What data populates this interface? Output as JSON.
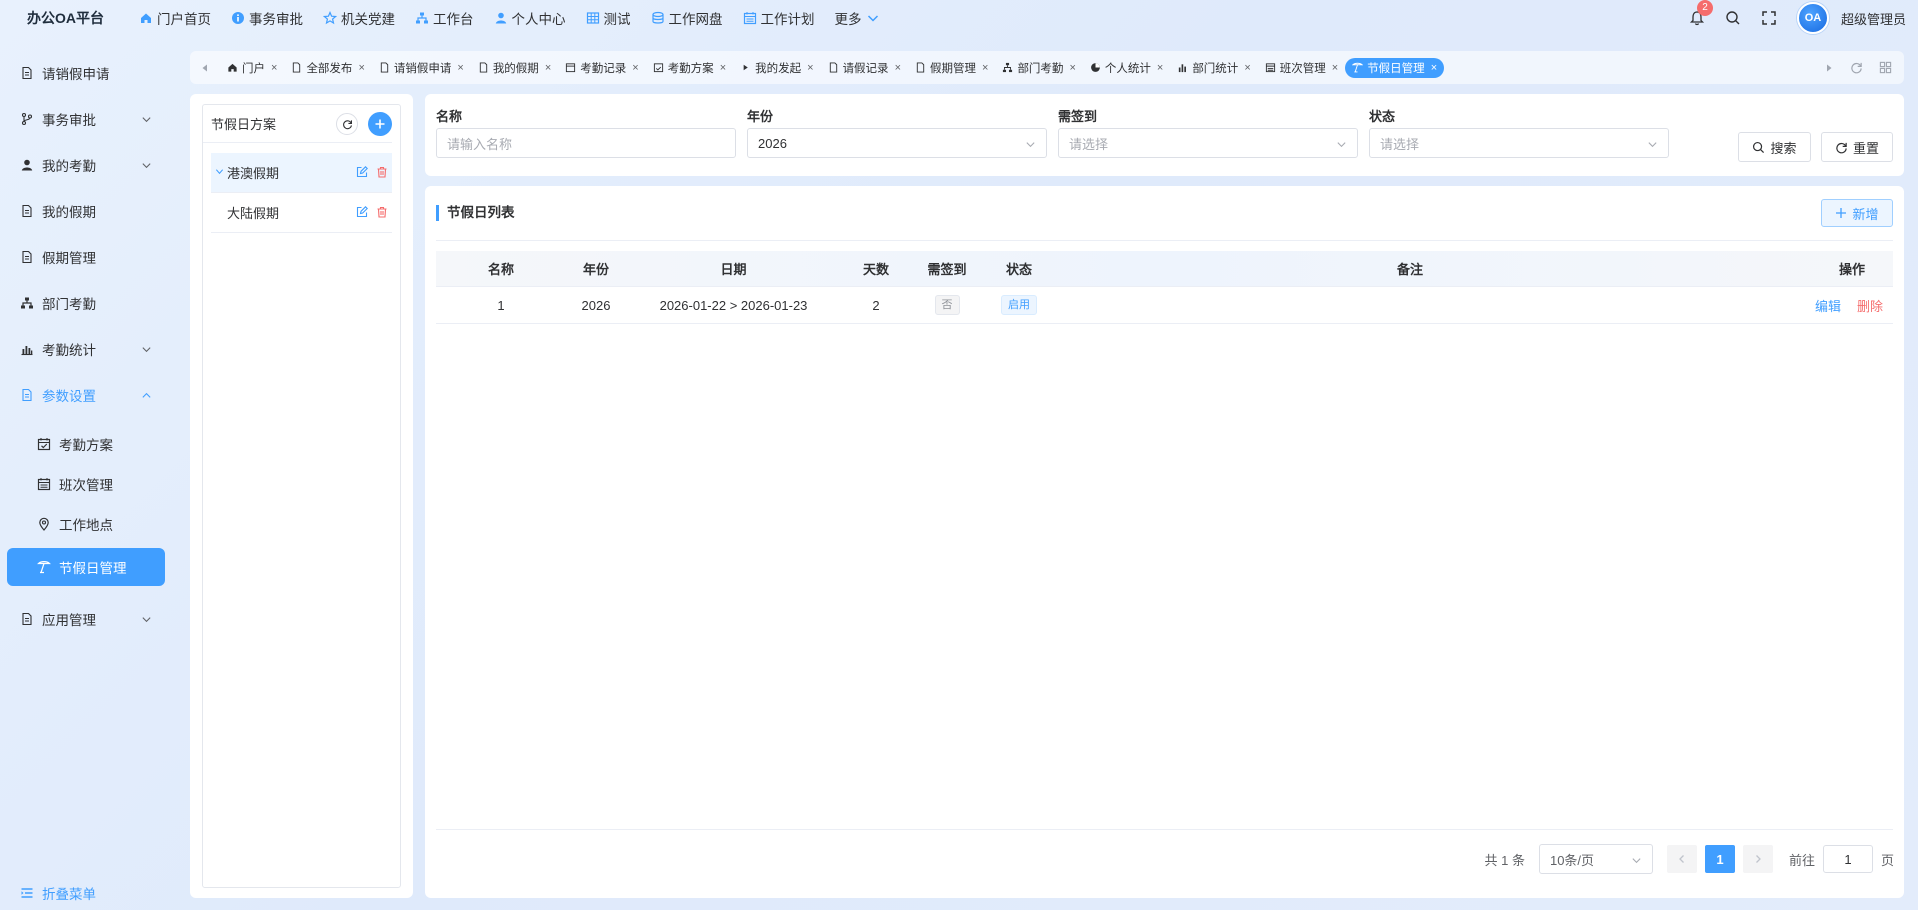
{
  "app": {
    "title": "办公OA平台",
    "username": "超级管理员",
    "avatar_text": "OA",
    "notification_count": "2"
  },
  "topnav": [
    {
      "label": "门户首页",
      "icon": "home-icon"
    },
    {
      "label": "事务审批",
      "icon": "info-icon"
    },
    {
      "label": "机关党建",
      "icon": "star-icon"
    },
    {
      "label": "工作台",
      "icon": "org-icon"
    },
    {
      "label": "个人中心",
      "icon": "user-icon"
    },
    {
      "label": "测试",
      "icon": "grid-icon"
    },
    {
      "label": "工作网盘",
      "icon": "database-icon"
    },
    {
      "label": "工作计划",
      "icon": "calendar-icon"
    },
    {
      "label": "更多",
      "icon": "chevron-down-icon"
    }
  ],
  "sidebar": {
    "items": [
      {
        "label": "请销假申请",
        "icon": "doc-icon"
      },
      {
        "label": "事务审批",
        "icon": "branch-icon",
        "expandable": true
      },
      {
        "label": "我的考勤",
        "icon": "user-icon",
        "expandable": true
      },
      {
        "label": "我的假期",
        "icon": "doc-icon"
      },
      {
        "label": "假期管理",
        "icon": "doc-icon"
      },
      {
        "label": "部门考勤",
        "icon": "org-icon"
      },
      {
        "label": "考勤统计",
        "icon": "chart-icon",
        "expandable": true
      },
      {
        "label": "参数设置",
        "icon": "doc-icon",
        "expandable": true,
        "expanded": true
      }
    ],
    "sub_items": [
      {
        "label": "考勤方案",
        "icon": "calendar-check-icon"
      },
      {
        "label": "班次管理",
        "icon": "calendar-icon"
      },
      {
        "label": "工作地点",
        "icon": "location-icon"
      },
      {
        "label": "节假日管理",
        "icon": "holiday-icon",
        "active": true
      }
    ],
    "after_items": [
      {
        "label": "应用管理",
        "icon": "doc-icon",
        "expandable": true
      }
    ],
    "collapse_label": "折叠菜单"
  },
  "tabs": [
    {
      "label": "门户",
      "icon": "home-icon"
    },
    {
      "label": "全部发布",
      "icon": "doc-icon"
    },
    {
      "label": "请销假申请",
      "icon": "doc-icon"
    },
    {
      "label": "我的假期",
      "icon": "doc-icon"
    },
    {
      "label": "考勤记录",
      "icon": "calendar-icon"
    },
    {
      "label": "考勤方案",
      "icon": "calendar-check-icon"
    },
    {
      "label": "我的发起",
      "icon": "play-icon"
    },
    {
      "label": "请假记录",
      "icon": "doc-icon"
    },
    {
      "label": "假期管理",
      "icon": "doc-icon"
    },
    {
      "label": "部门考勤",
      "icon": "org-icon"
    },
    {
      "label": "个人统计",
      "icon": "pie-icon"
    },
    {
      "label": "部门统计",
      "icon": "chart-icon"
    },
    {
      "label": "班次管理",
      "icon": "calendar-icon"
    },
    {
      "label": "节假日管理",
      "icon": "holiday-icon",
      "active": true
    }
  ],
  "left_panel": {
    "title": "节假日方案",
    "nodes": [
      {
        "label": "港澳假期",
        "selected": true
      },
      {
        "label": "大陆假期",
        "selected": false
      }
    ]
  },
  "search": {
    "name": {
      "label": "名称",
      "placeholder": "请输入名称"
    },
    "year": {
      "label": "年份",
      "value": "2026"
    },
    "need_sign": {
      "label": "需签到",
      "placeholder": "请选择"
    },
    "status": {
      "label": "状态",
      "placeholder": "请选择"
    },
    "search_button": "搜索",
    "reset_button": "重置"
  },
  "table": {
    "title": "节假日列表",
    "add_button": "新增",
    "columns": [
      "名称",
      "年份",
      "日期",
      "天数",
      "需签到",
      "状态",
      "备注",
      "操作"
    ],
    "rows": [
      {
        "name": "1",
        "year": "2026",
        "date": "2026-01-22 > 2026-01-23",
        "days": "2",
        "need_sign": "否",
        "status": "启用",
        "remark": "",
        "edit": "编辑",
        "delete": "删除"
      }
    ]
  },
  "pagination": {
    "total_text": "共 1 条",
    "page_size": "10条/页",
    "current_page": "1",
    "goto_label": "前往",
    "goto_value": "1",
    "page_suffix": "页"
  },
  "colors": {
    "primary": "#409eff",
    "danger": "#f56c6c",
    "text": "#303133"
  }
}
